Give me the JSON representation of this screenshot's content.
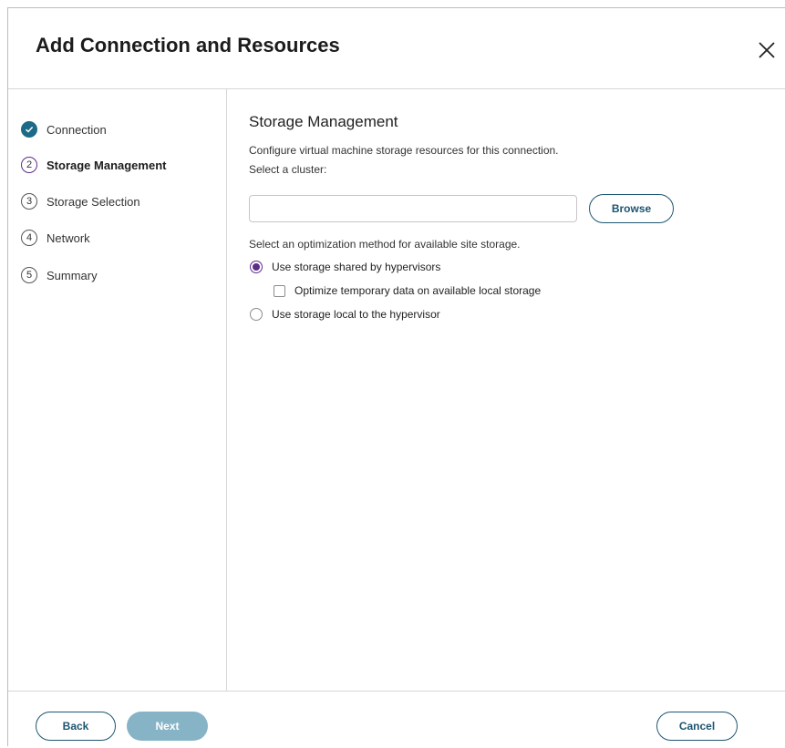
{
  "dialog": {
    "title": "Add Connection and Resources"
  },
  "steps": [
    {
      "number": "1",
      "label": "Connection",
      "state": "done"
    },
    {
      "number": "2",
      "label": "Storage Management",
      "state": "active"
    },
    {
      "number": "3",
      "label": "Storage Selection",
      "state": "pending"
    },
    {
      "number": "4",
      "label": "Network",
      "state": "pending"
    },
    {
      "number": "5",
      "label": "Summary",
      "state": "pending"
    }
  ],
  "main": {
    "title": "Storage Management",
    "description": "Configure virtual machine storage resources for this connection.",
    "cluster_label": "Select a cluster:",
    "cluster_value": "",
    "browse_label": "Browse",
    "optimization_label": "Select an optimization method for available site storage.",
    "option_shared": "Use storage shared by hypervisors",
    "option_optimize_temp": "Optimize temporary data on available local storage",
    "option_local": "Use storage local to the hypervisor"
  },
  "footer": {
    "back_label": "Back",
    "next_label": "Next",
    "cancel_label": "Cancel"
  },
  "colors": {
    "accent_purple": "#5b2d8c",
    "done_teal": "#1d6a88",
    "button_outline": "#1d5570",
    "next_disabled": "#86b4c6"
  },
  "icons": {
    "close": "close-icon",
    "done": "checkmark-icon"
  }
}
